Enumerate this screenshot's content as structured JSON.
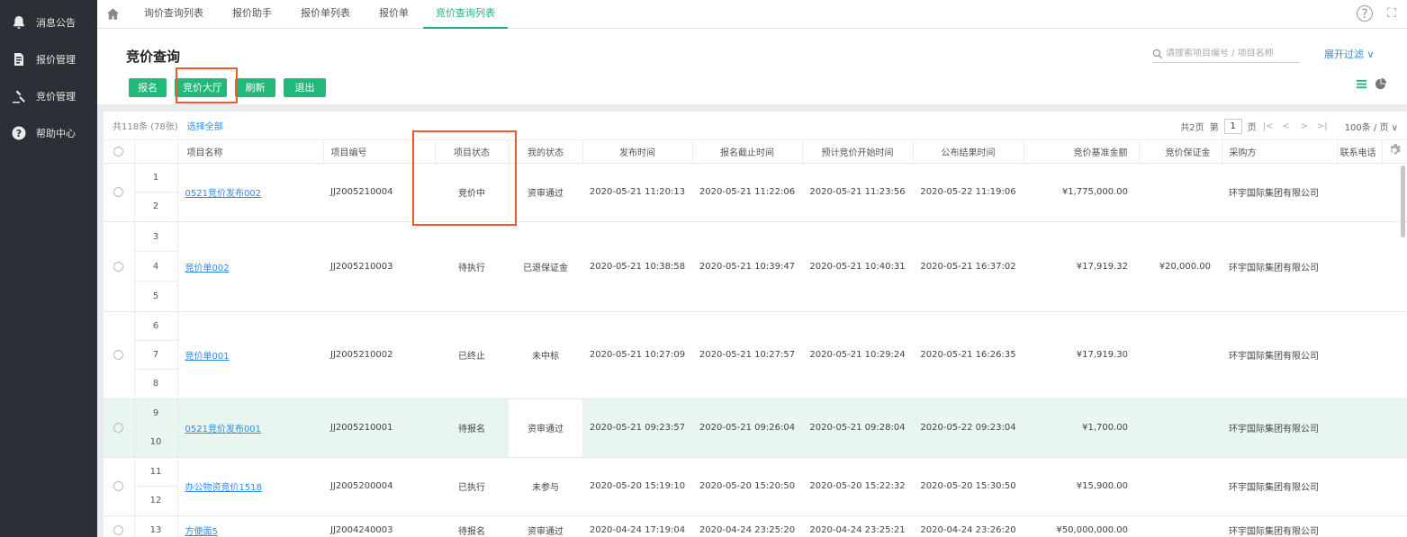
{
  "sidebar": {
    "items": [
      {
        "label": "消息公告",
        "icon": "bell-icon"
      },
      {
        "label": "报价管理",
        "icon": "document-icon"
      },
      {
        "label": "竞价管理",
        "icon": "gavel-icon"
      },
      {
        "label": "帮助中心",
        "icon": "help-icon"
      }
    ]
  },
  "topbar": {
    "tabs": [
      {
        "label": "询价查询列表"
      },
      {
        "label": "报价助手"
      },
      {
        "label": "报价单列表"
      },
      {
        "label": "报价单"
      },
      {
        "label": "竞价查询列表"
      }
    ],
    "active_tab": 4,
    "help_glyph": "?",
    "fullscreen_glyph": "⛶"
  },
  "header": {
    "title": "竞价查询",
    "buttons": {
      "signup": "报名",
      "hall": "竞价大厅",
      "refresh": "刷新",
      "exit": "退出"
    },
    "search_placeholder": "请搜索项目编号 / 项目名称",
    "expand_filter": "展开过滤 ∨"
  },
  "table_bar": {
    "count_text": "共118条 (78张)",
    "select_all": "选择全部",
    "pager": {
      "total_pages": "共2页",
      "page_prefix": "第",
      "current_page": "1",
      "page_suffix": "页",
      "first": "|<",
      "prev": "<",
      "next": ">",
      "last": ">|",
      "page_size": "100条 / 页 ∨"
    }
  },
  "columns": {
    "name": "项目名称",
    "code": "项目编号",
    "status": "项目状态",
    "my_status": "我的状态",
    "publish_time": "发布时间",
    "signup_deadline": "报名截止时间",
    "expected_start": "预计竞价开始时间",
    "result_time": "公布结果时间",
    "base_amount": "竞价基准金额",
    "deposit": "竞价保证金",
    "buyer": "采购方",
    "phone": "联系电话"
  },
  "rows": [
    {
      "nums": [
        "1",
        "2"
      ],
      "name": "0521竞价发布002",
      "code": "JJ2005210004",
      "status": "竞价中",
      "my_status": "资审通过",
      "publish_time": "2020-05-21 11:20:13",
      "signup_deadline": "2020-05-21 11:22:06",
      "expected_start": "2020-05-21 11:23:56",
      "result_time": "2020-05-22 11:19:06",
      "base_amount": "¥1,775,000.00",
      "deposit": "",
      "buyer": "环宇国际集团有限公司",
      "phone": ""
    },
    {
      "nums": [
        "3",
        "4",
        "5"
      ],
      "name": "竞价单002",
      "code": "JJ2005210003",
      "status": "待执行",
      "my_status": "已退保证金",
      "publish_time": "2020-05-21 10:38:58",
      "signup_deadline": "2020-05-21 10:39:47",
      "expected_start": "2020-05-21 10:40:31",
      "result_time": "2020-05-21 16:37:02",
      "base_amount": "¥17,919.32",
      "deposit": "¥20,000.00",
      "buyer": "环宇国际集团有限公司",
      "phone": ""
    },
    {
      "nums": [
        "6",
        "7",
        "8"
      ],
      "name": "竞价单001",
      "code": "JJ2005210002",
      "status": "已终止",
      "my_status": "未中标",
      "publish_time": "2020-05-21 10:27:09",
      "signup_deadline": "2020-05-21 10:27:57",
      "expected_start": "2020-05-21 10:29:24",
      "result_time": "2020-05-21 16:26:35",
      "base_amount": "¥17,919.30",
      "deposit": "",
      "buyer": "环宇国际集团有限公司",
      "phone": ""
    },
    {
      "nums": [
        "9",
        "10"
      ],
      "name": "0521竞价发布001",
      "code": "JJ2005210001",
      "status": "待报名",
      "my_status": "资审通过",
      "publish_time": "2020-05-21 09:23:57",
      "signup_deadline": "2020-05-21 09:26:04",
      "expected_start": "2020-05-21 09:28:04",
      "result_time": "2020-05-22 09:23:04",
      "base_amount": "¥1,700.00",
      "deposit": "",
      "buyer": "环宇国际集团有限公司",
      "phone": ""
    },
    {
      "nums": [
        "11",
        "12"
      ],
      "name": "办公物资竞价1518",
      "code": "JJ2005200004",
      "status": "已执行",
      "my_status": "未参与",
      "publish_time": "2020-05-20 15:19:10",
      "signup_deadline": "2020-05-20 15:20:50",
      "expected_start": "2020-05-20 15:22:32",
      "result_time": "2020-05-20 15:30:50",
      "base_amount": "¥15,900.00",
      "deposit": "",
      "buyer": "环宇国际集团有限公司",
      "phone": ""
    },
    {
      "nums": [
        "13"
      ],
      "name": "方便面5",
      "code": "JJ2004240003",
      "status": "待报名",
      "my_status": "资审通过",
      "publish_time": "2020-04-24 17:19:04",
      "signup_deadline": "2020-04-24 23:25:20",
      "expected_start": "2020-04-24 23:25:21",
      "result_time": "2020-04-24 23:26:20",
      "base_amount": "¥50,000,000.00",
      "deposit": "",
      "buyer": "环宇国际集团有限公司",
      "phone": ""
    }
  ],
  "colors": {
    "accent": "#22b87a",
    "link": "#2d8cf0",
    "highlight": "#f05a28",
    "sidebar": "#2b2f36"
  }
}
